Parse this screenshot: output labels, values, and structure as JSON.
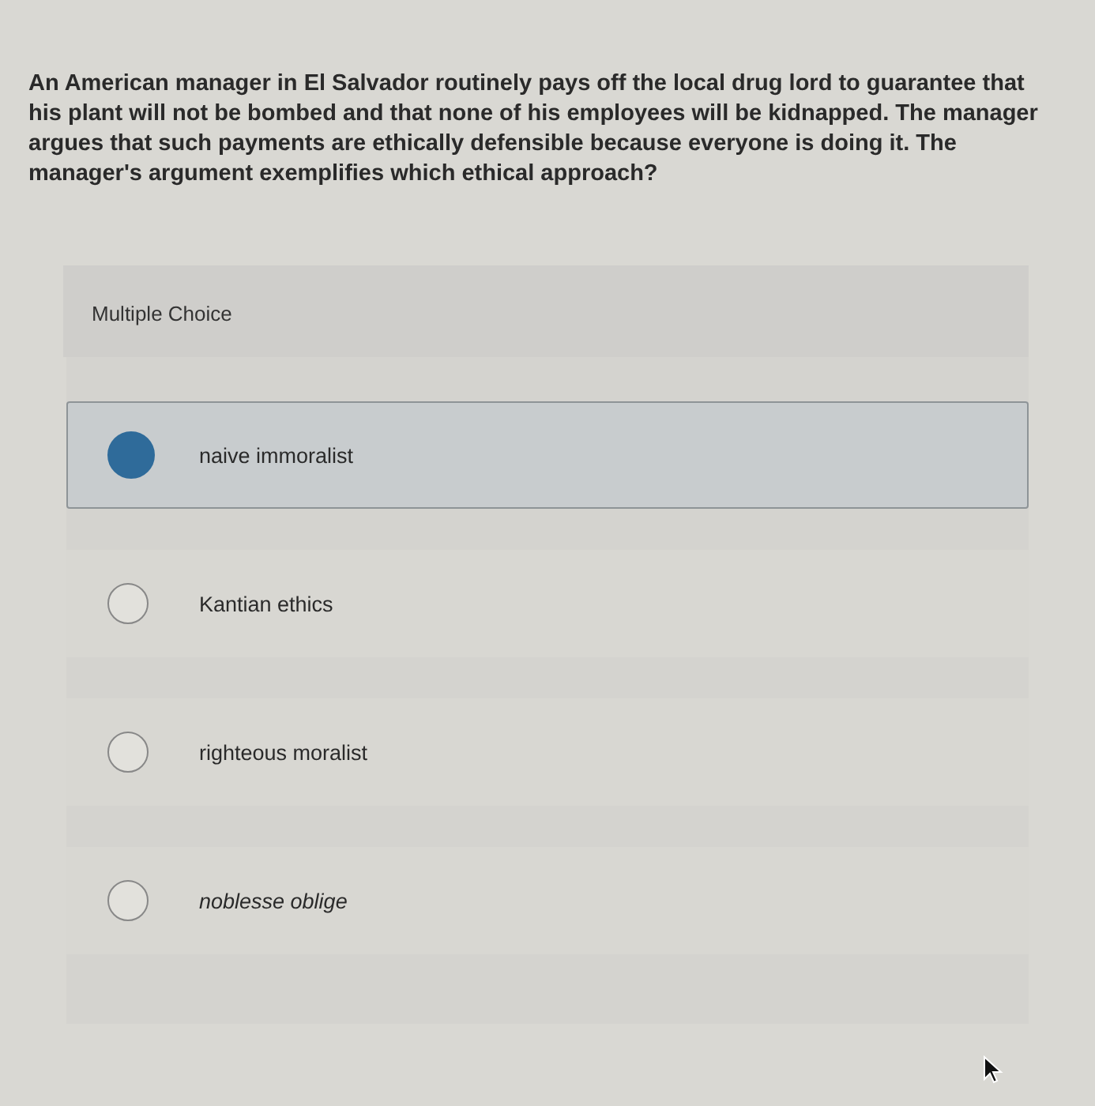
{
  "question": "An American manager in El Salvador routinely pays off the local drug lord to guarantee that his plant will not be bombed and that none of his employees will be kidnapped. The manager argues that such payments are ethically defensible because everyone is doing it. The manager's argument exemplifies which ethical approach?",
  "section_label": "Multiple Choice",
  "options": [
    {
      "label": "naive immoralist",
      "selected": true,
      "italic": false
    },
    {
      "label": "Kantian ethics",
      "selected": false,
      "italic": false
    },
    {
      "label": "righteous moralist",
      "selected": false,
      "italic": false
    },
    {
      "label": "noblesse oblige",
      "selected": false,
      "italic": true
    }
  ]
}
